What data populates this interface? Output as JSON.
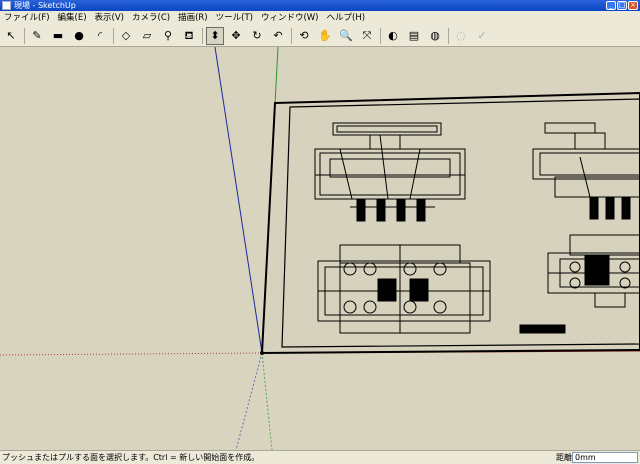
{
  "window": {
    "title": "現場 - SketchUp"
  },
  "menu": [
    "ファイル(F)",
    "編集(E)",
    "表示(V)",
    "カメラ(C)",
    "描画(R)",
    "ツール(T)",
    "ウィンドウ(W)",
    "ヘルプ(H)"
  ],
  "toolbar": {
    "tools": [
      {
        "icon": "select-arrow-icon",
        "glyph": "↖"
      },
      {
        "icon": "pencil-icon",
        "glyph": "✎"
      },
      {
        "icon": "rectangle-icon",
        "glyph": "▬"
      },
      {
        "icon": "circle-icon",
        "glyph": "●"
      },
      {
        "icon": "arc-icon",
        "glyph": "◜"
      },
      {
        "icon": "eraser-icon",
        "glyph": "◇"
      },
      {
        "icon": "eraser2-icon",
        "glyph": "▱"
      },
      {
        "icon": "tape-measure-icon",
        "glyph": "⚲"
      },
      {
        "icon": "paint-bucket-icon",
        "glyph": "⛾"
      },
      {
        "icon": "push-pull-icon",
        "glyph": "⬍"
      },
      {
        "icon": "move-icon",
        "glyph": "✥"
      },
      {
        "icon": "rotate-icon",
        "glyph": "↻"
      },
      {
        "icon": "follow-me-icon",
        "glyph": "↶"
      },
      {
        "icon": "orbit-icon",
        "glyph": "⟲"
      },
      {
        "icon": "pan-hand-icon",
        "glyph": "✋"
      },
      {
        "icon": "zoom-icon",
        "glyph": "🔍"
      },
      {
        "icon": "zoom-extents-icon",
        "glyph": "⤧"
      },
      {
        "icon": "get-models-icon",
        "glyph": "◐"
      },
      {
        "icon": "share-model-icon",
        "glyph": "▤"
      },
      {
        "icon": "google-earth-icon",
        "glyph": "◍"
      },
      {
        "icon": "component-icon",
        "glyph": "◌"
      },
      {
        "icon": "disabled-tool-icon",
        "glyph": "✓"
      }
    ],
    "active_index": 9,
    "disabled_from": 20
  },
  "status": {
    "hint": "プッシュまたはプルする面を選択します。Ctrl = 新しい開始面を作成。",
    "measure_label": "距離",
    "measure_value": "0mm"
  }
}
